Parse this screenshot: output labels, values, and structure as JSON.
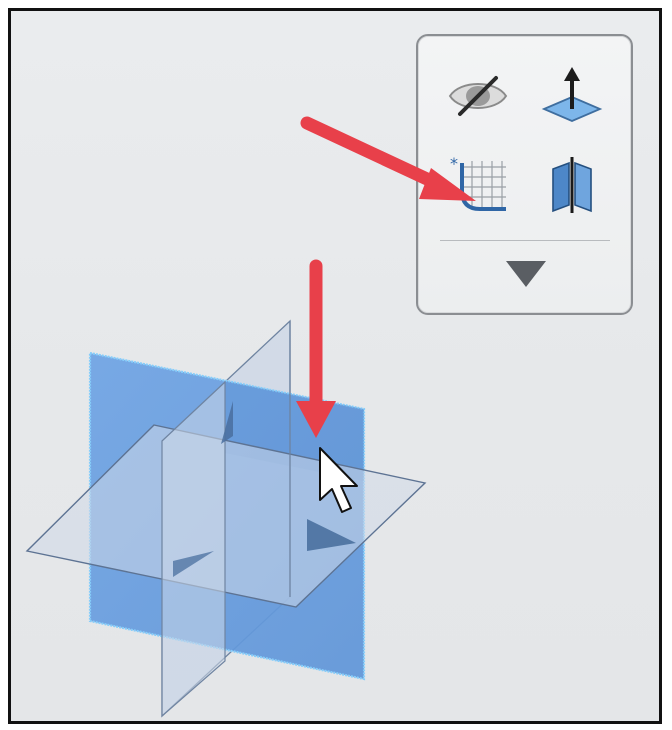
{
  "canvas": {
    "background": "#e8eaec"
  },
  "toolbar": {
    "items": [
      {
        "name": "hide-show-icon"
      },
      {
        "name": "normal-to-icon"
      },
      {
        "name": "sketch-icon"
      },
      {
        "name": "section-view-icon"
      }
    ],
    "more": {
      "name": "more-dropdown-icon"
    }
  },
  "annotations": {
    "arrow_color": "#e8404a"
  },
  "model": {
    "selected_plane_color": "#6b9fe0",
    "plane_color": "#c7d3e4",
    "edge_color": "#5f7592",
    "highlight_edge": "#7ec8ff"
  }
}
